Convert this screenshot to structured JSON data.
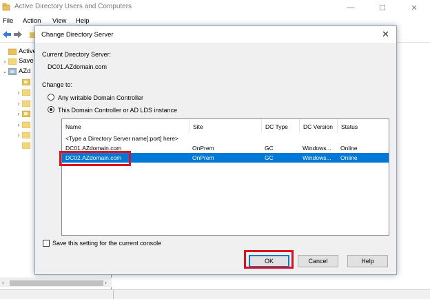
{
  "window": {
    "title": "Active Directory Users and Computers",
    "minimize": "—",
    "maximize": "☐",
    "close": "✕"
  },
  "menu": [
    "File",
    "Action",
    "View",
    "Help"
  ],
  "tree": {
    "items": [
      {
        "label": "Active D",
        "expander": ""
      },
      {
        "label": "Save",
        "expander": "›"
      },
      {
        "label": "AZd",
        "expander": "⌄"
      }
    ]
  },
  "dialog": {
    "title": "Change Directory Server",
    "close": "✕",
    "current_label": "Current Directory Server:",
    "current_value": "DC01.AZdomain.com",
    "change_to_label": "Change to:",
    "option_any": "Any writable Domain Controller",
    "option_this": "This Domain Controller or AD LDS instance",
    "columns": [
      "Name",
      "Site",
      "DC Type",
      "DC Version",
      "Status"
    ],
    "placeholder_row": "<Type a Directory Server name[:port] here>",
    "rows": [
      {
        "name": "DC01.AZdomain.com",
        "site": "OnPrem",
        "type": "GC",
        "version": "Windows...",
        "status": "Online",
        "selected": false
      },
      {
        "name": "DC02.AZdomain.com",
        "site": "OnPrem",
        "type": "GC",
        "version": "Windows...",
        "status": "Online",
        "selected": true
      }
    ],
    "save_setting": "Save this setting for the current console",
    "ok": "OK",
    "cancel": "Cancel",
    "help": "Help"
  },
  "colors": {
    "selection": "#0078d7",
    "highlight_box": "#e0101c"
  }
}
